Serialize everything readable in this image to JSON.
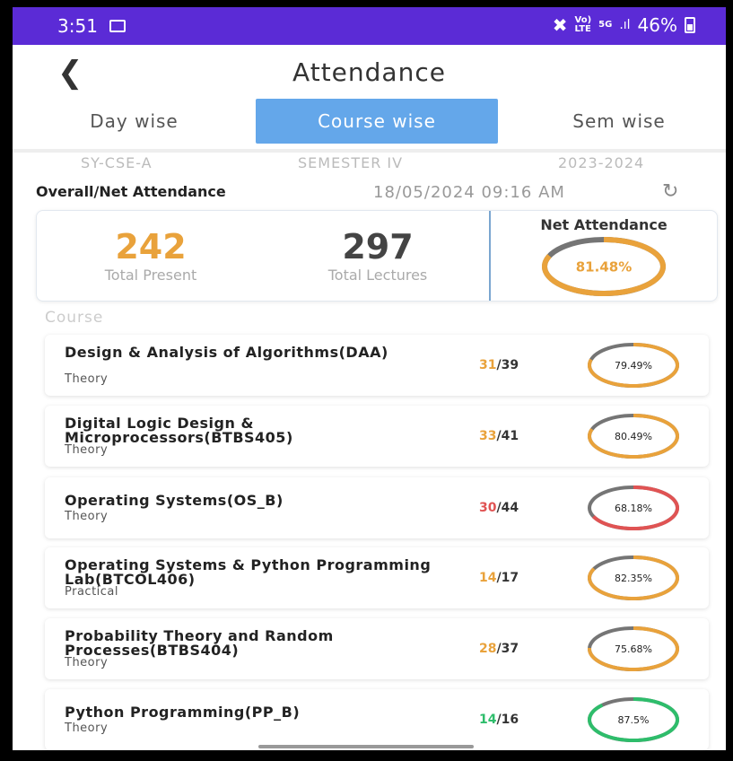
{
  "status_bar": {
    "time": "3:51",
    "network_label": "Vo))\nLTE",
    "network_5g": "5G",
    "battery": "46%"
  },
  "header": {
    "title": "Attendance",
    "back_icon": "chevron-left-icon"
  },
  "tabs": [
    {
      "label": "Day wise",
      "active": false
    },
    {
      "label": "Course wise",
      "active": true
    },
    {
      "label": "Sem wise",
      "active": false
    }
  ],
  "meta": {
    "class": "SY-CSE-A",
    "semester": "SEMESTER IV",
    "year": "2023-2024"
  },
  "overall": {
    "heading": "Overall/Net Attendance",
    "timestamp": "18/05/2024 09:16 AM",
    "total_present": "242",
    "total_present_label": "Total Present",
    "total_lectures": "297",
    "total_lectures_label": "Total Lectures",
    "net_title": "Net Attendance",
    "net_percent": "81.48%",
    "net_fraction": 0.8148
  },
  "colors": {
    "accent": "#e9a23b",
    "red": "#e05353",
    "green": "#2ebd6b",
    "track": "#757575",
    "tab_active": "#64a7ea"
  },
  "course_section_label": "Course",
  "courses": [
    {
      "name": "Design & Analysis of Algorithms(DAA)",
      "type": "Theory",
      "present": "31",
      "total": "/39",
      "percent": "79.49%",
      "fraction": 0.7949,
      "color": "#e9a23b"
    },
    {
      "name": "Digital Logic Design & Microprocessors(BTBS405)",
      "type": "Theory",
      "present": "33",
      "total": "/41",
      "percent": "80.49%",
      "fraction": 0.8049,
      "color": "#e9a23b"
    },
    {
      "name": "Operating Systems(OS_B)",
      "type": "Theory",
      "present": "30",
      "total": "/44",
      "percent": "68.18%",
      "fraction": 0.6818,
      "color": "#e05353"
    },
    {
      "name": "Operating Systems & Python Programming Lab(BTCOL406)",
      "type": "Practical",
      "present": "14",
      "total": "/17",
      "percent": "82.35%",
      "fraction": 0.8235,
      "color": "#e9a23b"
    },
    {
      "name": "Probability Theory and Random Processes(BTBS404)",
      "type": "Theory",
      "present": "28",
      "total": "/37",
      "percent": "75.68%",
      "fraction": 0.7568,
      "color": "#e9a23b"
    },
    {
      "name": "Python Programming(PP_B)",
      "type": "Theory",
      "present": "14",
      "total": "/16",
      "percent": "87.5%",
      "fraction": 0.875,
      "color": "#2ebd6b"
    }
  ]
}
